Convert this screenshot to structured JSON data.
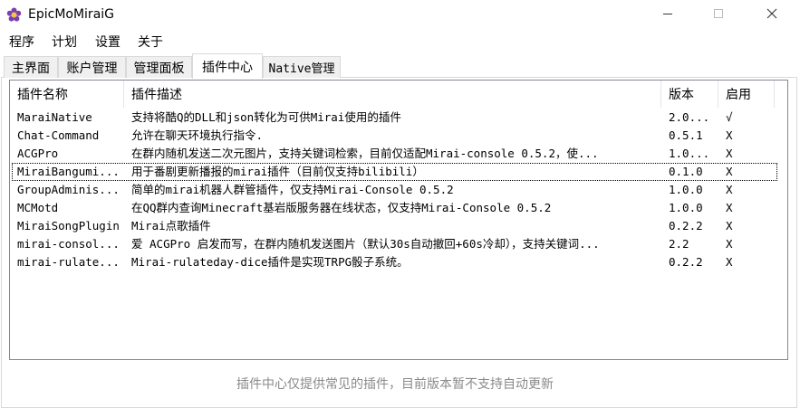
{
  "window": {
    "title": "EpicMoMiraiG",
    "icon": "flower-logo-icon",
    "controls": {
      "minimize": "minimize-icon",
      "maximize": "maximize-icon",
      "close": "close-icon"
    }
  },
  "menu": {
    "items": [
      "程序",
      "计划",
      "设置",
      "关于"
    ]
  },
  "tabs": [
    {
      "label": "主界面",
      "active": false
    },
    {
      "label": "账户管理",
      "active": false
    },
    {
      "label": "管理面板",
      "active": false
    },
    {
      "label": "插件中心",
      "active": true
    },
    {
      "label": "Native管理",
      "active": false
    }
  ],
  "plugin_list": {
    "columns": [
      "插件名称",
      "插件描述",
      "版本",
      "启用"
    ],
    "rows": [
      {
        "name": "MaraiNative",
        "desc": "支持将酷Q的DLL和json转化为可供Mirai使用的插件",
        "version": "2.0...",
        "enabled": "√"
      },
      {
        "name": "Chat-Command",
        "desc": "允许在聊天环境执行指令.",
        "version": "0.5.1",
        "enabled": "X"
      },
      {
        "name": "ACGPro",
        "desc": "在群内随机发送二次元图片，支持关键词检索，目前仅适配Mirai-console 0.5.2，使...",
        "version": "1.0...",
        "enabled": "X"
      },
      {
        "name": "MiraiBangumi...",
        "desc": "用于番剧更新播报的mirai插件（目前仅支持bilibili）",
        "version": "0.1.0",
        "enabled": "X"
      },
      {
        "name": "GroupAdminis...",
        "desc": "简单的mirai机器人群管插件，仅支持Mirai-Console 0.5.2",
        "version": "1.0.0",
        "enabled": "X"
      },
      {
        "name": "MCMotd",
        "desc": "在QQ群内查询Minecraft基岩版服务器在线状态，仅支持Mirai-Console 0.5.2",
        "version": "1.0.0",
        "enabled": "X"
      },
      {
        "name": "MiraiSongPlugin",
        "desc": "Mirai点歌插件",
        "version": "0.2.2",
        "enabled": "X"
      },
      {
        "name": "mirai-consol...",
        "desc": "爱 ACGPro 启发而写，在群内随机发送图片（默认30s自动撤回+60s冷却），支持关键词...",
        "version": "2.2",
        "enabled": "X"
      },
      {
        "name": "mirai-rulate...",
        "desc": "Mirai-rulateday-dice插件是实现TRPG骰子系统。",
        "version": "0.2.2",
        "enabled": "X"
      }
    ]
  },
  "footer_note": "插件中心仅提供常见的插件，目前版本暂不支持自动更新"
}
